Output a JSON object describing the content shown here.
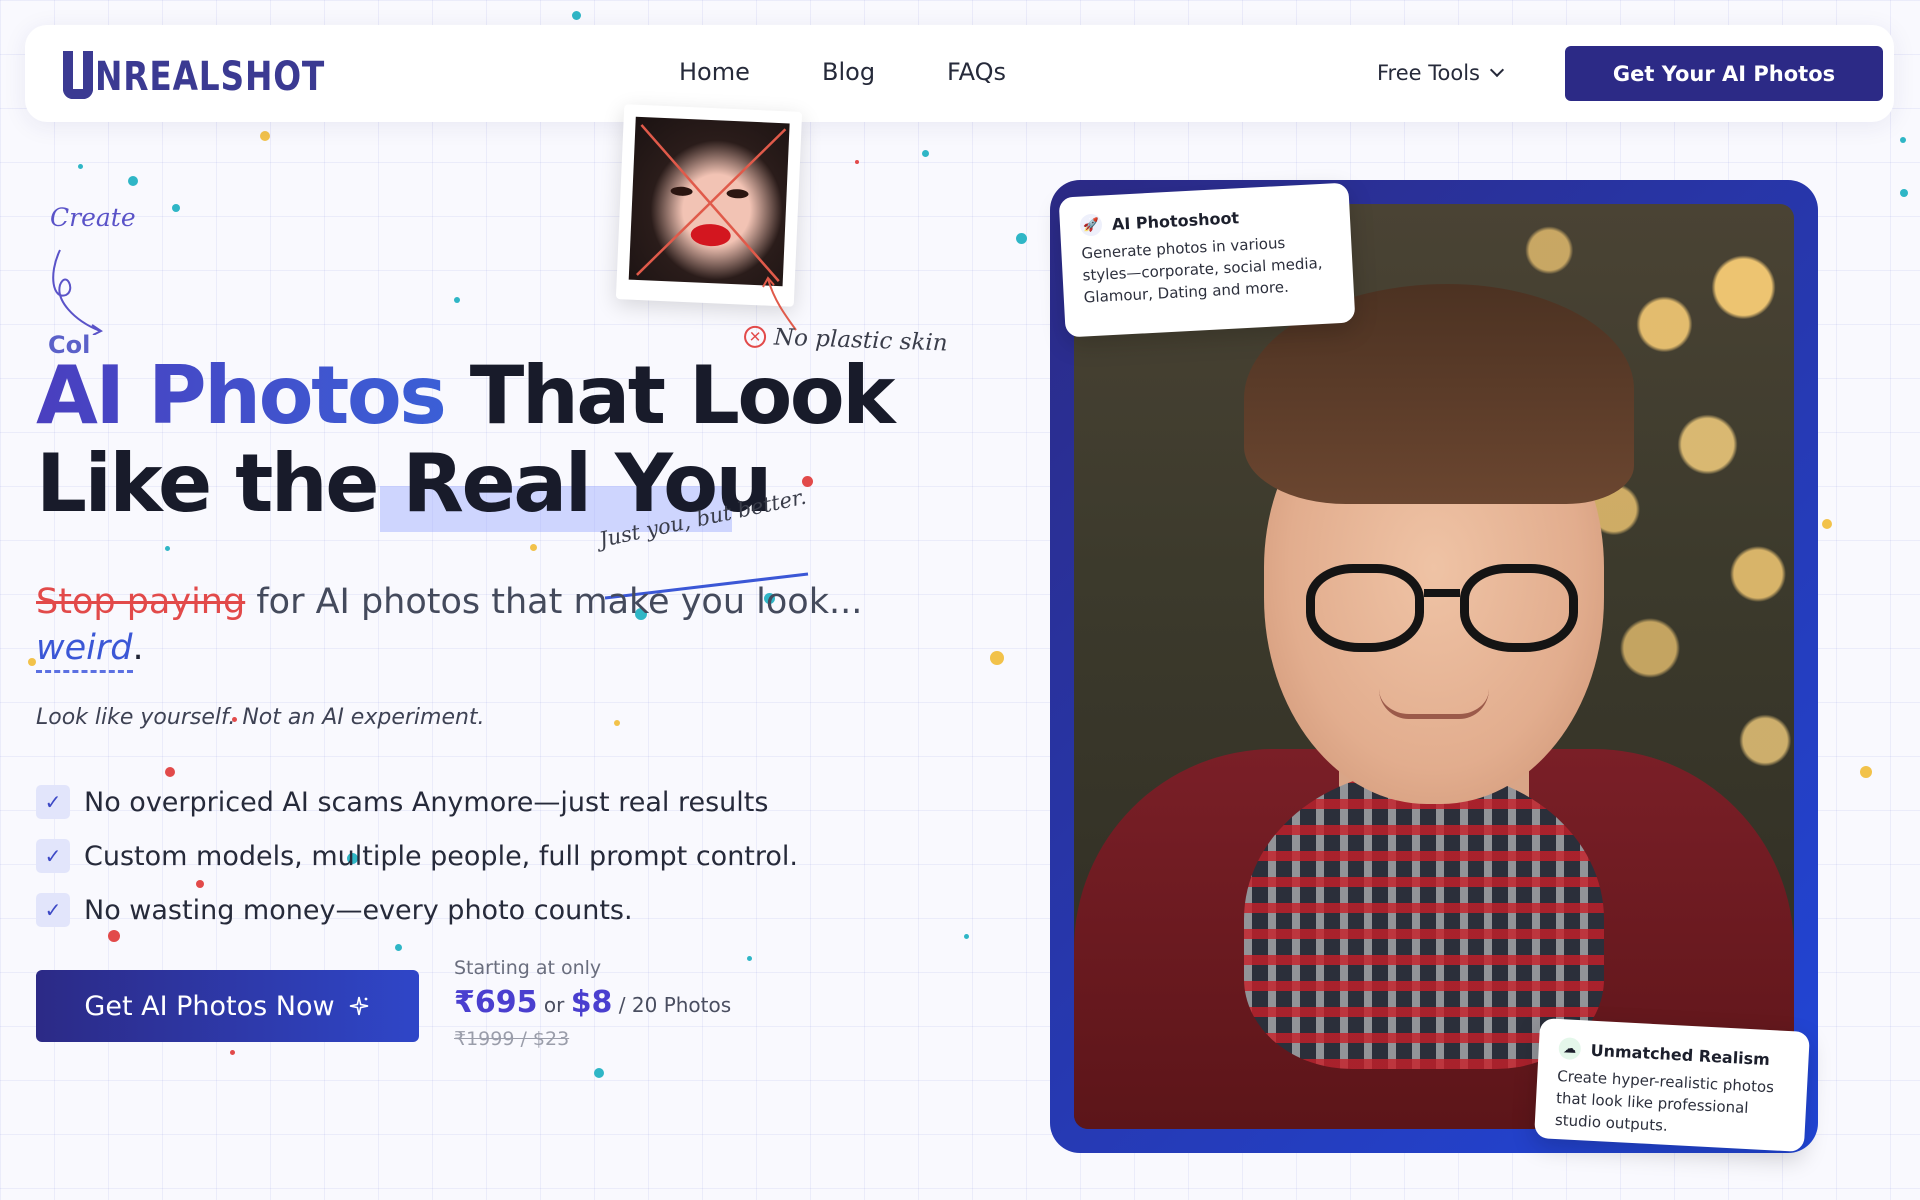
{
  "nav": {
    "logo": "NREALSHOT",
    "links": [
      "Home",
      "Blog",
      "FAQs"
    ],
    "free_tools": "Free Tools",
    "cta": "Get Your AI Photos"
  },
  "hero": {
    "doodle_create": "Create",
    "doodle_col": "Col",
    "no_plastic": "No plastic skin",
    "headline_accent": "AI Photos",
    "headline_rest1": " That Look",
    "headline_line2a": "Like the ",
    "headline_highlight": "Real You",
    "just_you": "Just you, but better.",
    "sub_strike": "Stop paying",
    "sub_rest": " for AI photos that make you look...",
    "sub_weird": "weird",
    "sub_period": ".",
    "tagline": "Look like yourself. Not an AI experiment.",
    "features": [
      "No overpriced AI scams Anymore—just real results",
      "Custom models, multiple people, full prompt control.",
      "No wasting money—every photo counts."
    ],
    "cta": "Get AI Photos Now",
    "price_label": "Starting at only",
    "price_inr": "₹695",
    "price_or": " or ",
    "price_usd": "$8",
    "price_suffix": " / 20 Photos",
    "price_old": "₹1999 / $23"
  },
  "cards": {
    "photoshoot_title": "AI Photoshoot",
    "photoshoot_text": "Generate photos in various styles—corporate, social media, Glamour, Dating and more.",
    "realism_title": "Unmatched Realism",
    "realism_text": "Create hyper-realistic photos that look like professional studio outputs."
  },
  "icons": {
    "check": "check-icon",
    "sparkle": "sparkle-icon",
    "rocket": "rocket-icon",
    "chevron": "chevron-down-icon",
    "x_circle": "x-circle-icon"
  },
  "colors": {
    "brand": "#2c2a86",
    "accent": "#3b57d6",
    "strike": "#e24a4a"
  }
}
